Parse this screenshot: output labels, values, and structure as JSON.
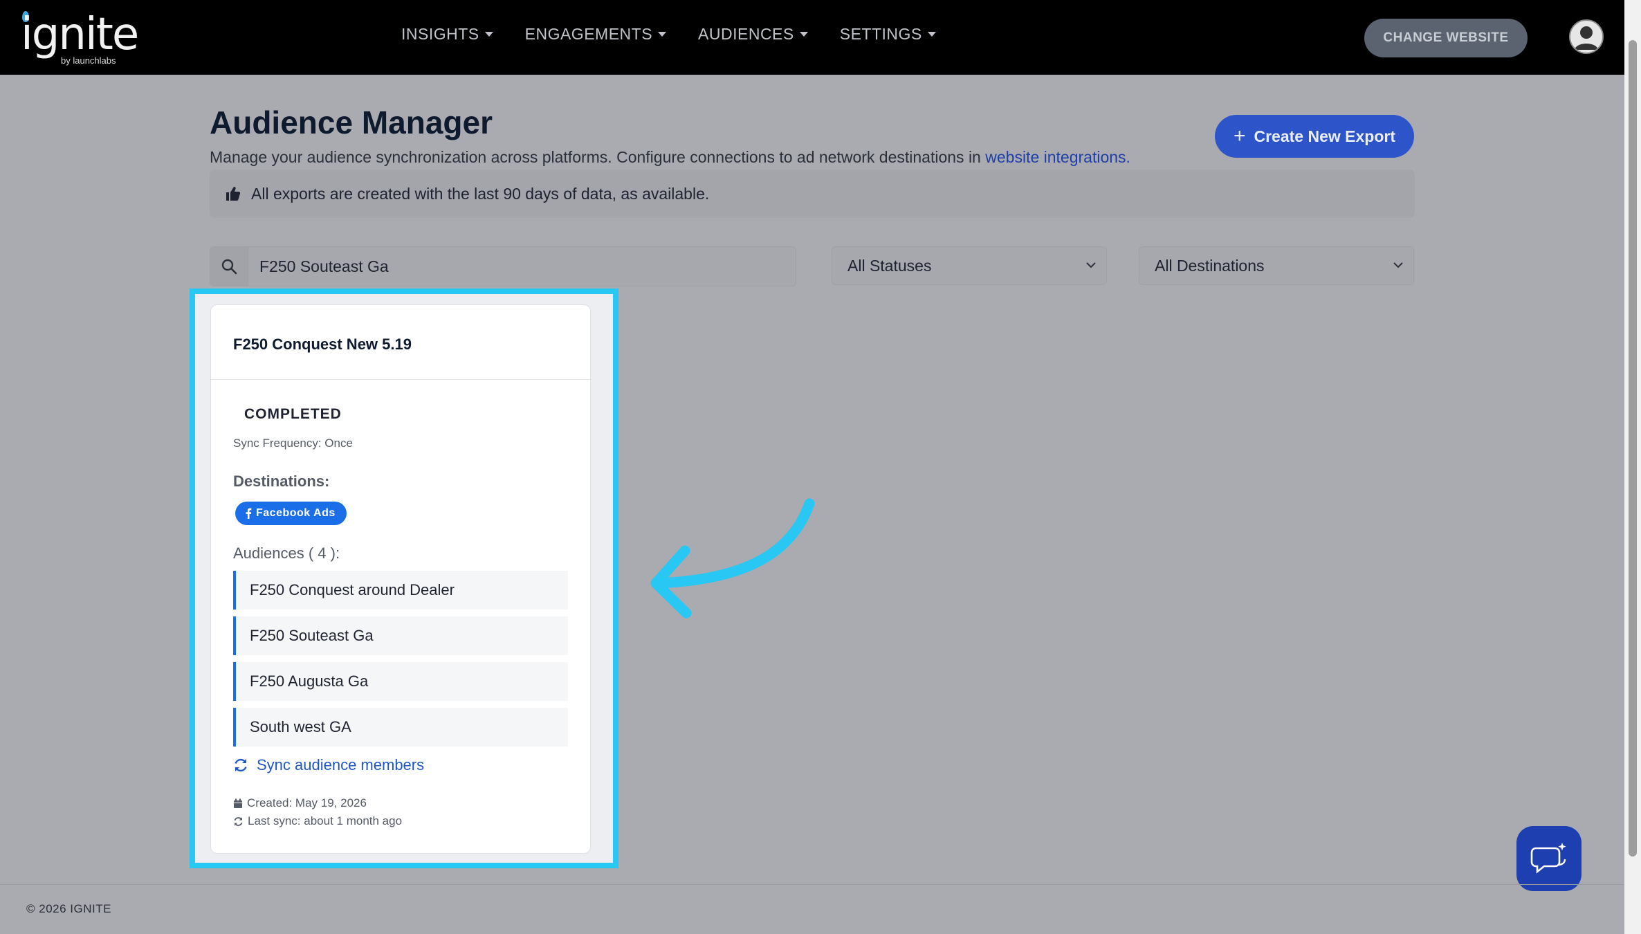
{
  "header": {
    "logo_text": "ignite",
    "logo_sub": "by launchlabs",
    "nav": [
      "INSIGHTS",
      "ENGAGEMENTS",
      "AUDIENCES",
      "SETTINGS"
    ],
    "change_website": "CHANGE WEBSITE"
  },
  "page": {
    "title": "Audience Manager",
    "subtitle_text": "Manage your audience synchronization across platforms. Configure connections to ad network destinations in",
    "subtitle_link": "website integrations.",
    "create_button": "Create New Export",
    "info": "All exports are created with the last 90 days of data, as available."
  },
  "filters": {
    "search_value": "F250 Souteast Ga",
    "status_select": "All Statuses",
    "destination_select": "All Destinations"
  },
  "card": {
    "title": "F250 Conquest New 5.19",
    "status": "COMPLETED",
    "sync_frequency": "Sync Frequency: Once",
    "destinations_label": "Destinations:",
    "destination_badge": "Facebook Ads",
    "audiences_label": "Audiences ( 4 ):",
    "audiences": [
      "F250 Conquest around Dealer",
      "F250 Souteast Ga",
      "F250 Augusta Ga",
      "South west GA"
    ],
    "sync_link": "Sync audience members",
    "created": "Created: May 19, 2026",
    "last_sync": "Last sync: about 1 month ago"
  },
  "footer": "© 2026 IGNITE",
  "colors": {
    "accent": "#2d54c8",
    "highlight": "#29c7f3",
    "facebook": "#1a6ee8"
  }
}
